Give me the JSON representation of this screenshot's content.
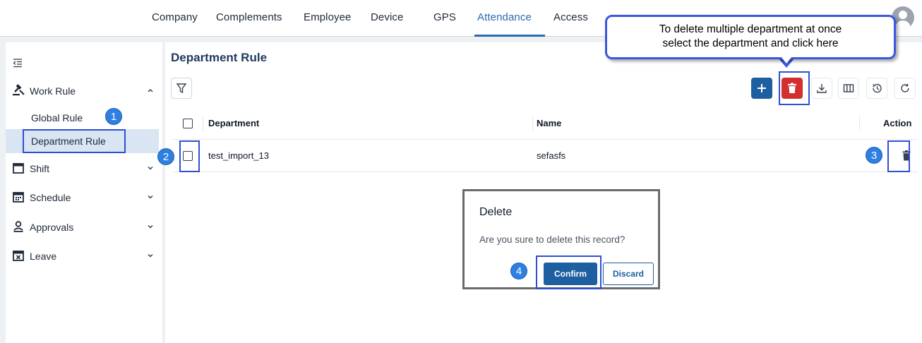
{
  "topnav": {
    "items": [
      "Company",
      "Complements",
      "Employee",
      "Device",
      "GPS",
      "Attendance",
      "Access"
    ],
    "active": "Attendance",
    "accent_color": "#2b6cb0"
  },
  "sidebar": {
    "items": [
      {
        "label": "Work Rule",
        "icon": "gavel-icon",
        "expanded": true
      },
      {
        "label": "Shift",
        "icon": "calendar-blank-icon"
      },
      {
        "label": "Schedule",
        "icon": "calendar-grid-icon"
      },
      {
        "label": "Approvals",
        "icon": "person-check-icon"
      },
      {
        "label": "Leave",
        "icon": "calendar-x-icon"
      }
    ],
    "subitems": [
      {
        "label": "Global Rule"
      },
      {
        "label": "Department Rule",
        "active": true
      }
    ]
  },
  "main": {
    "title": "Department Rule",
    "table": {
      "headers": {
        "department": "Department",
        "name": "Name",
        "action": "Action"
      },
      "rows": [
        {
          "department": "test_import_13",
          "name": "sefasfs"
        }
      ]
    }
  },
  "dialog": {
    "title": "Delete",
    "message": "Are you sure to delete this record?",
    "confirm_label": "Confirm",
    "discard_label": "Discard"
  },
  "annotations": {
    "callout_line1": "To delete multiple department at once",
    "callout_line2": "select the department and click here",
    "steps": [
      "1",
      "2",
      "3",
      "4"
    ]
  },
  "colors": {
    "primary": "#1d5fa0",
    "danger": "#d32f2f",
    "annotation_blue": "#2f4fd6",
    "badge_blue": "#2d7fe0"
  }
}
